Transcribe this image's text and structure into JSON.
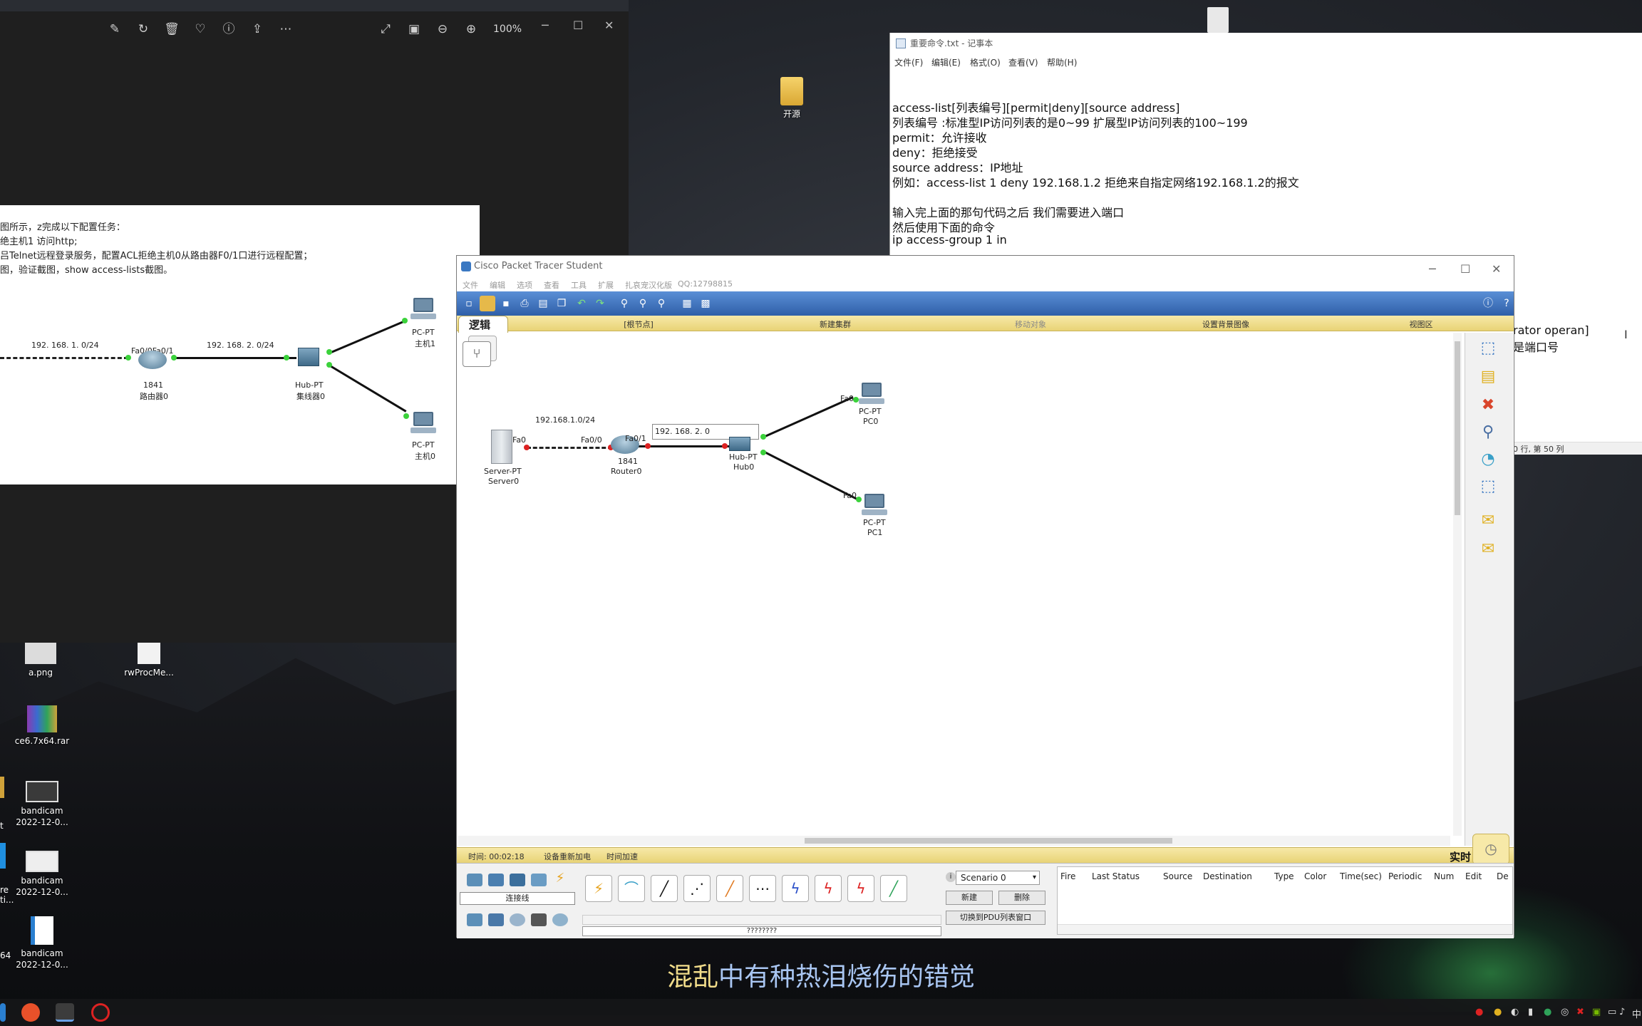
{
  "photo_viewer": {
    "zoom": "100%",
    "icons": [
      "edit-icon",
      "rotate-icon",
      "delete-icon",
      "favorite-icon",
      "info-icon",
      "share-icon",
      "more-icon",
      "expand-icon",
      "fit-icon",
      "zoom-out-icon",
      "zoom-in-icon"
    ],
    "task_lines": [
      "图所示，z完成以下配置任务：",
      "绝主机1 访问http;",
      "吕Telnet远程登录服务，配置ACL拒绝主机0从路由器F0/1口进行远程配置；",
      "图，验证截图，show access-lists截图。"
    ],
    "net1": "192. 168. 1. 0/24",
    "net2": "192. 168. 2. 0/24",
    "router_ports": "Fa0/0Fa0/1",
    "router_model": "1841",
    "router_name": "路由器0",
    "hub_model": "Hub-PT",
    "hub_name": "集线器0",
    "pc1_model": "PC-PT",
    "pc1_name": "主机1",
    "pc0_model": "PC-PT",
    "pc0_name": "主机0"
  },
  "notepad": {
    "title": "重要命令.txt - 记事本",
    "menu": [
      "文件(F)",
      "编辑(E)",
      "格式(O)",
      "查看(V)",
      "帮助(H)"
    ],
    "lines": [
      "access-list[列表编号][permit|deny][source address]",
      "列表编号 :标准型IP访问列表的是0~99  扩展型IP访问列表的100~199",
      "permit：允许接收",
      "deny：拒绝接受",
      "source address：IP地址",
      "例如：access-list 1 deny 192.168.1.2 拒绝来自指定网络192.168.1.2的报文",
      "",
      "输入完上面的那句代码之后 我们需要进入端口",
      "然后使用下面的命令",
      "ip access-group 1 in"
    ],
    "overflow1": "rator operan]",
    "overflow2": "是端口号",
    "status": "0 行, 第 50 列"
  },
  "desktop": {
    "folder_label": "开源",
    "icons": [
      {
        "label": "a.png"
      },
      {
        "label": "rwProcMe..."
      },
      {
        "label": "ce6.7x64.rar"
      },
      {
        "label": "bandicam\n2022-12-0..."
      },
      {
        "label": "bandicam\n2022-12-0..."
      },
      {
        "label": "bandicam\n2022-12-0..."
      }
    ],
    "edge_labels": [
      "t",
      "re",
      "ti...",
      "64"
    ]
  },
  "packet_tracer": {
    "title": "Cisco Packet Tracer Student",
    "menu": [
      "文件",
      "编辑",
      "选项",
      "查看",
      "工具",
      "扩展",
      "扎哀宠汉化版",
      "QQ:12798815"
    ],
    "logic_tab": "逻辑",
    "logic_bar": [
      "[根节点]",
      "新建集群",
      "移动对象",
      "设置背景图像",
      "视图区"
    ],
    "topology": {
      "server_port": "Fa0",
      "server_model": "Server-PT",
      "server_name": "Server0",
      "net1": "192.168.1.0/24",
      "router_port0": "Fa0/0",
      "router_port1": "Fa0/1",
      "router_model": "1841",
      "router_name": "Router0",
      "net2_note": "192. 168. 2. 0",
      "hub_model": "Hub-PT",
      "hub_name": "Hub0",
      "pc0_port": "Fa0",
      "pc0_model": "PC-PT",
      "pc0_name": "PC0",
      "pc1_port": "Fa0",
      "pc1_model": "PC-PT",
      "pc1_name": "PC1"
    },
    "status": {
      "time": "时间: 00:02:18",
      "power_cycle": "设备重新加电",
      "fast_forward": "时间加速",
      "realtime": "实时"
    },
    "bottom": {
      "device_label": "连接线",
      "scenario": "Scenario 0",
      "new_btn": "新建",
      "delete_btn": "删除",
      "toggle_pdu": "切换到PDU列表窗口",
      "tooltip": "????????",
      "pdu_columns": [
        "Fire",
        "Last Status",
        "Source",
        "Destination",
        "Type",
        "Color",
        "Time(sec)",
        "Periodic",
        "Num",
        "Edit",
        "De"
      ]
    }
  },
  "subtitle": {
    "part1": "混乱",
    "part2": "中有种热泪烧伤的错觉"
  },
  "taskbar": {
    "tray_text": "中"
  }
}
